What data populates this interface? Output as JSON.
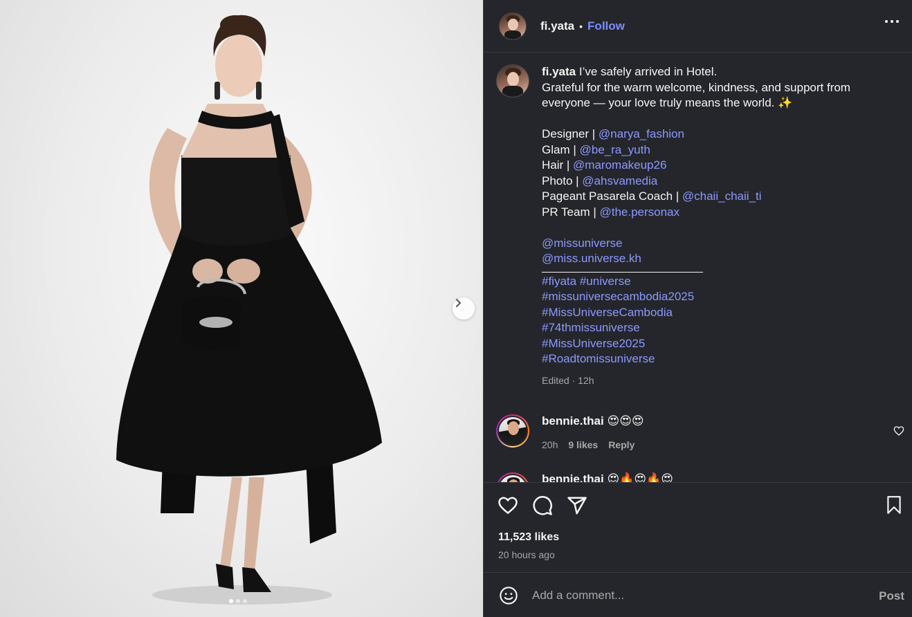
{
  "post": {
    "username": "fi.yata",
    "follow_label": "Follow",
    "separator": "•",
    "image_count": 3,
    "active_image": 1
  },
  "caption": {
    "username": "fi.yata",
    "intro": " I’ve safely arrived in Hotel.",
    "line2": "Grateful for the warm welcome, kindness, and support from everyone — your love truly means the world. ✨",
    "credits": [
      {
        "role": "Designer | ",
        "handle": "@narya_fashion"
      },
      {
        "role": "Glam | ",
        "handle": "@be_ra_yuth"
      },
      {
        "role": "Hair | ",
        "handle": "@maromakeup26"
      },
      {
        "role": "Photo | ",
        "handle": "@ahsvamedia"
      },
      {
        "role": "Pageant Pasarela Coach | ",
        "handle": "@chaii_chaii_ti"
      },
      {
        "role": "PR Team | ",
        "handle": "@the.personax"
      }
    ],
    "mentions": [
      "@missuniverse",
      "@miss.universe.kh"
    ],
    "hashtags_line1": [
      "#fiyata",
      "#universe"
    ],
    "hashtags": [
      "#missuniversecambodia2025",
      "#MissUniverseCambodia",
      "#74thmissuniverse",
      "#MissUniverse2025",
      "#Roadtomissuniverse"
    ],
    "meta": "Edited · 12h"
  },
  "comments": [
    {
      "username": "bennie.thai",
      "text": "😍😍😍",
      "time": "20h",
      "likes": "9 likes",
      "reply": "Reply"
    },
    {
      "username": "bennie.thai",
      "text": "😍🔥😍🔥😍"
    }
  ],
  "actions": {
    "likes": "11,523 likes",
    "time": "20 hours ago"
  },
  "comment_box": {
    "placeholder": "Add a comment...",
    "post_label": "Post"
  }
}
